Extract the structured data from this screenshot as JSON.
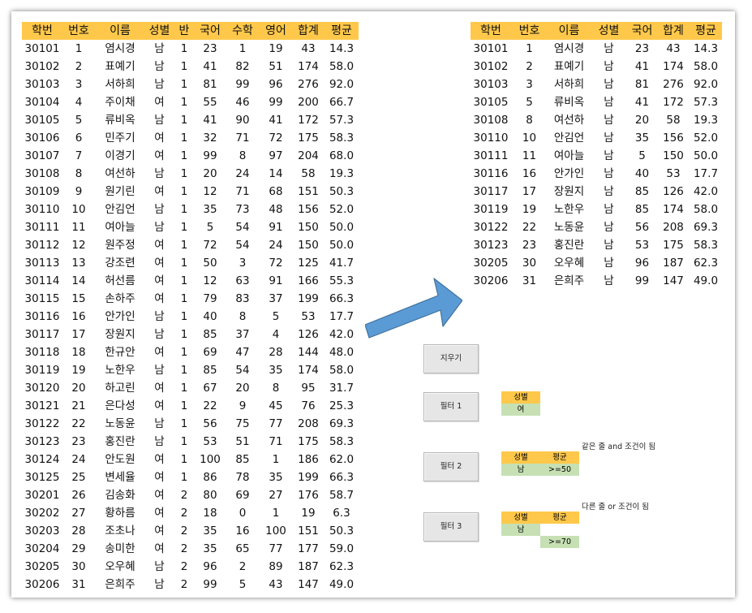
{
  "source_table": {
    "headers": [
      "학번",
      "번호",
      "이름",
      "성별",
      "반",
      "국어",
      "수학",
      "영어",
      "합계",
      "평균"
    ],
    "rows": [
      [
        "30101",
        "1",
        "염시경",
        "남",
        "1",
        "23",
        "1",
        "19",
        "43",
        "14.3"
      ],
      [
        "30102",
        "2",
        "표예기",
        "남",
        "1",
        "41",
        "82",
        "51",
        "174",
        "58.0"
      ],
      [
        "30103",
        "3",
        "서하희",
        "남",
        "1",
        "81",
        "99",
        "96",
        "276",
        "92.0"
      ],
      [
        "30104",
        "4",
        "주이채",
        "여",
        "1",
        "55",
        "46",
        "99",
        "200",
        "66.7"
      ],
      [
        "30105",
        "5",
        "류비옥",
        "남",
        "1",
        "41",
        "90",
        "41",
        "172",
        "57.3"
      ],
      [
        "30106",
        "6",
        "민주기",
        "여",
        "1",
        "32",
        "71",
        "72",
        "175",
        "58.3"
      ],
      [
        "30107",
        "7",
        "이경기",
        "여",
        "1",
        "99",
        "8",
        "97",
        "204",
        "68.0"
      ],
      [
        "30108",
        "8",
        "여선하",
        "남",
        "1",
        "20",
        "24",
        "14",
        "58",
        "19.3"
      ],
      [
        "30109",
        "9",
        "원기린",
        "여",
        "1",
        "12",
        "71",
        "68",
        "151",
        "50.3"
      ],
      [
        "30110",
        "10",
        "안김언",
        "남",
        "1",
        "35",
        "73",
        "48",
        "156",
        "52.0"
      ],
      [
        "30111",
        "11",
        "여아늘",
        "남",
        "1",
        "5",
        "54",
        "91",
        "150",
        "50.0"
      ],
      [
        "30112",
        "12",
        "원주정",
        "여",
        "1",
        "72",
        "54",
        "24",
        "150",
        "50.0"
      ],
      [
        "30113",
        "13",
        "강조련",
        "여",
        "1",
        "50",
        "3",
        "72",
        "125",
        "41.7"
      ],
      [
        "30114",
        "14",
        "허선름",
        "여",
        "1",
        "12",
        "63",
        "91",
        "166",
        "55.3"
      ],
      [
        "30115",
        "15",
        "손하주",
        "여",
        "1",
        "79",
        "83",
        "37",
        "199",
        "66.3"
      ],
      [
        "30116",
        "16",
        "안가인",
        "남",
        "1",
        "40",
        "8",
        "5",
        "53",
        "17.7"
      ],
      [
        "30117",
        "17",
        "장원지",
        "남",
        "1",
        "85",
        "37",
        "4",
        "126",
        "42.0"
      ],
      [
        "30118",
        "18",
        "한규안",
        "여",
        "1",
        "69",
        "47",
        "28",
        "144",
        "48.0"
      ],
      [
        "30119",
        "19",
        "노한우",
        "남",
        "1",
        "85",
        "54",
        "35",
        "174",
        "58.0"
      ],
      [
        "30120",
        "20",
        "하고린",
        "여",
        "1",
        "67",
        "20",
        "8",
        "95",
        "31.7"
      ],
      [
        "30121",
        "21",
        "은다성",
        "여",
        "1",
        "22",
        "9",
        "45",
        "76",
        "25.3"
      ],
      [
        "30122",
        "22",
        "노동윤",
        "남",
        "1",
        "56",
        "75",
        "77",
        "208",
        "69.3"
      ],
      [
        "30123",
        "23",
        "홍진란",
        "남",
        "1",
        "53",
        "51",
        "71",
        "175",
        "58.3"
      ],
      [
        "30124",
        "24",
        "안도원",
        "여",
        "1",
        "100",
        "85",
        "1",
        "186",
        "62.0"
      ],
      [
        "30125",
        "25",
        "변세율",
        "여",
        "1",
        "86",
        "78",
        "35",
        "199",
        "66.3"
      ],
      [
        "30201",
        "26",
        "김송화",
        "여",
        "2",
        "80",
        "69",
        "27",
        "176",
        "58.7"
      ],
      [
        "30202",
        "27",
        "황하름",
        "여",
        "2",
        "18",
        "0",
        "1",
        "19",
        "6.3"
      ],
      [
        "30203",
        "28",
        "조초나",
        "여",
        "2",
        "35",
        "16",
        "100",
        "151",
        "50.3"
      ],
      [
        "30204",
        "29",
        "송미한",
        "여",
        "2",
        "35",
        "65",
        "77",
        "177",
        "59.0"
      ],
      [
        "30205",
        "30",
        "오우혜",
        "남",
        "2",
        "96",
        "2",
        "89",
        "187",
        "62.3"
      ],
      [
        "30206",
        "31",
        "은희주",
        "남",
        "2",
        "99",
        "5",
        "43",
        "147",
        "49.0"
      ]
    ]
  },
  "result_table": {
    "headers": [
      "학번",
      "번호",
      "이름",
      "성별",
      "국어",
      "합계",
      "평균"
    ],
    "rows": [
      [
        "30101",
        "1",
        "염시경",
        "남",
        "23",
        "43",
        "14.3"
      ],
      [
        "30102",
        "2",
        "표예기",
        "남",
        "41",
        "174",
        "58.0"
      ],
      [
        "30103",
        "3",
        "서하희",
        "남",
        "81",
        "276",
        "92.0"
      ],
      [
        "30105",
        "5",
        "류비옥",
        "남",
        "41",
        "172",
        "57.3"
      ],
      [
        "30108",
        "8",
        "여선하",
        "남",
        "20",
        "58",
        "19.3"
      ],
      [
        "30110",
        "10",
        "안김언",
        "남",
        "35",
        "156",
        "52.0"
      ],
      [
        "30111",
        "11",
        "여아늘",
        "남",
        "5",
        "150",
        "50.0"
      ],
      [
        "30116",
        "16",
        "안가인",
        "남",
        "40",
        "53",
        "17.7"
      ],
      [
        "30117",
        "17",
        "장원지",
        "남",
        "85",
        "126",
        "42.0"
      ],
      [
        "30119",
        "19",
        "노한우",
        "남",
        "85",
        "174",
        "58.0"
      ],
      [
        "30122",
        "22",
        "노동윤",
        "남",
        "56",
        "208",
        "69.3"
      ],
      [
        "30123",
        "23",
        "홍진란",
        "남",
        "53",
        "175",
        "58.3"
      ],
      [
        "30205",
        "30",
        "오우혜",
        "남",
        "96",
        "187",
        "62.3"
      ],
      [
        "30206",
        "31",
        "은희주",
        "남",
        "99",
        "147",
        "49.0"
      ]
    ]
  },
  "buttons": {
    "clear": "지우기",
    "filter1": "필터 1",
    "filter2": "필터 2",
    "filter3": "필터 3"
  },
  "criteria1": {
    "header": "성별",
    "value": "여"
  },
  "criteria2": {
    "headers": [
      "성별",
      "평균"
    ],
    "values": [
      "남",
      ">=50"
    ],
    "note": "같은 줄 and 조건이 됨"
  },
  "criteria3": {
    "headers": [
      "성별",
      "평균"
    ],
    "row1": [
      "남",
      ""
    ],
    "row2": [
      "",
      ">=70"
    ],
    "note": "다른 줄 or 조건이 됨"
  },
  "colors": {
    "header": "#ffc84a",
    "criteria_value": "#c6e0b4",
    "arrow": "#5b9bd5"
  }
}
